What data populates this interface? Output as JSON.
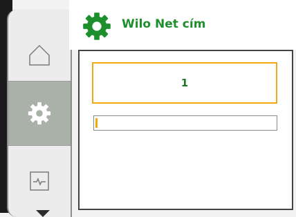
{
  "header": {
    "title": "Wilo Net cím",
    "icon": "gear-icon"
  },
  "nav": {
    "items": [
      {
        "name": "home",
        "icon": "home-icon",
        "selected": false
      },
      {
        "name": "settings",
        "icon": "gear-icon",
        "selected": true
      },
      {
        "name": "monitor",
        "icon": "monitor-icon",
        "selected": false
      }
    ],
    "scroll_icon": "chevron-down-icon"
  },
  "editor": {
    "value": "1",
    "progress_fraction": 0.01
  },
  "colors": {
    "brand_green": "#1d8f2c",
    "accent_orange": "#f2a90d",
    "selected_nav": "#a9b1a8"
  }
}
